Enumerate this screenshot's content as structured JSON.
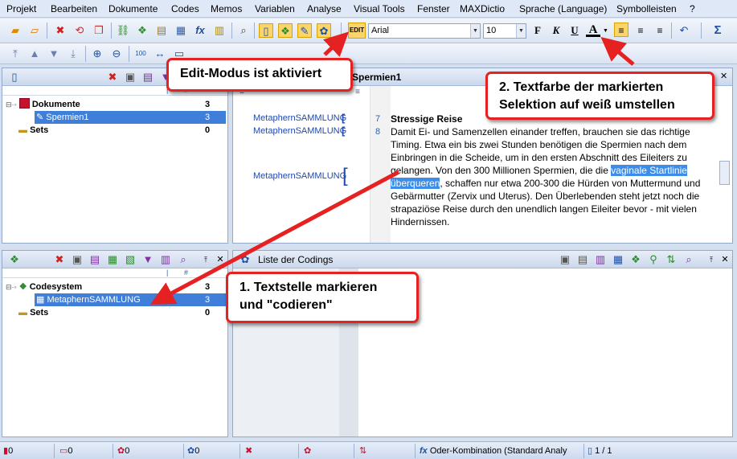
{
  "menu": [
    "Projekt",
    "Bearbeiten",
    "Dokumente",
    "Codes",
    "Memos",
    "Variablen",
    "Analyse",
    "Visual Tools",
    "Fenster",
    "MAXDictio",
    "Sprache (Language)",
    "Symbolleisten",
    "?"
  ],
  "toolbar": {
    "edit_label": "EDIT",
    "font_name": "Arial",
    "font_size": "10",
    "bold": "F",
    "italic": "K",
    "underline": "U",
    "font_color": "A",
    "sum": "Σ"
  },
  "document_browser": {
    "title": "Spermien1",
    "codes_in_margin": [
      "MetaphernSAMMLUNG",
      "MetaphernSAMMLUNG",
      "MetaphernSAMMLUNG"
    ],
    "line_numbers": [
      "7",
      "8"
    ],
    "heading": "Stressige Reise",
    "para_before": "Damit Ei- und Samenzellen einander treffen, brauchen sie das richtige Timing. Etwa ein bis zwei Stunden benötigen die Spermien nach dem Einbringen in die Scheide, um in den ersten Abschnitt des Eileiters zu gelangen. Von den 300 Millionen Spermien, die die ",
    "para_highlight": "vaginale Startlinie überqueren",
    "para_after": ", schaffen nur etwa 200-300 die Hürden von Muttermund und Gebärmutter (Zervix und Uterus). Den Überlebenden steht jetzt noch die strapaziöse Reise durch den unendlich langen Eileiter bevor - mit vielen Hindernissen."
  },
  "document_system": {
    "rows": [
      {
        "label": "Dokumente",
        "count": "3"
      },
      {
        "label": "Spermien1",
        "count": "3"
      },
      {
        "label": "Sets",
        "count": "0"
      }
    ]
  },
  "code_system": {
    "rows": [
      {
        "label": "Codesystem",
        "count": "3"
      },
      {
        "label": "MetaphernSAMMLUNG",
        "count": "3"
      },
      {
        "label": "Sets",
        "count": "0"
      }
    ]
  },
  "retrieved": {
    "title": "Liste der Codings"
  },
  "callouts": {
    "edit_mode": "Edit-Modus ist aktiviert",
    "textcolor_line1": "2. Textfarbe der markierten",
    "textcolor_line2": "Selektion auf weiß umstellen",
    "mark_line1": "1. Textstelle markieren",
    "mark_line2": "und \"codieren\""
  },
  "status": {
    "docs": "0",
    "memos": "0",
    "links": "0",
    "vars": "0",
    "mode": "Oder-Kombination (Standard Analy",
    "pages": "1 / 1"
  },
  "colors": {
    "accent": "#3f7ed9",
    "callout_border": "#e52121",
    "arrow": "#e52121",
    "highlight": "#3d8de8"
  }
}
